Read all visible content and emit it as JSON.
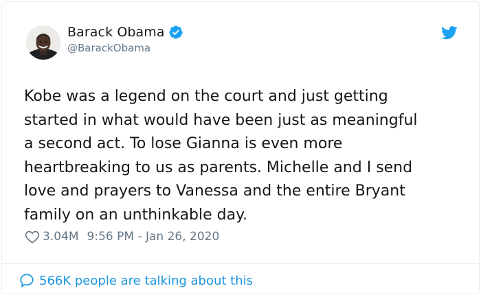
{
  "author": {
    "name": "Barack Obama",
    "handle": "@BarackObama",
    "verified": true
  },
  "tweet": {
    "text": "Kobe was a legend on the court and just getting\nstarted in what would have been just as meaningful\na second act. To lose Gianna is even more\nheartbreaking to us as parents. Michelle and I send\nlove and prayers to Vanessa and the entire Bryant\nfamily on an unthinkable day.",
    "likes": "3.04M",
    "timestamp": "9:56 PM - Jan 26, 2020"
  },
  "footer": {
    "talking": "566K people are talking about this"
  },
  "icons": {
    "brand": "twitter-bird-icon",
    "like": "heart-icon",
    "comments": "speech-bubble-icon",
    "verified": "verified-badge-icon"
  },
  "colors": {
    "accent": "#1da1f2",
    "text": "#14171a",
    "secondary": "#657786",
    "link": "#1b95e0"
  }
}
